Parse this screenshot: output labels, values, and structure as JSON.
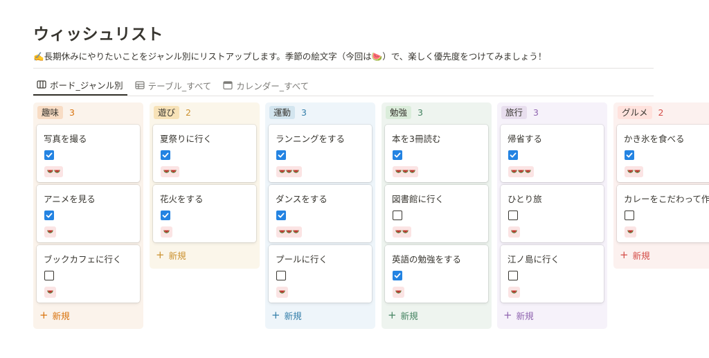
{
  "page": {
    "title": "ウィッシュリスト",
    "description": "✍️長期休みにやりたいことをジャンル別にリストアップします。季節の絵文字（今回は🍉）で、楽しく優先度をつけてみましょう！"
  },
  "tabs": [
    {
      "label": "ボード_ジャンル別",
      "icon": "board-icon",
      "active": true
    },
    {
      "label": "テーブル_すべて",
      "icon": "table-icon",
      "active": false
    },
    {
      "label": "カレンダー_すべて",
      "icon": "calendar-icon",
      "active": false
    }
  ],
  "new_label": "新規",
  "columns": [
    {
      "name": "趣味",
      "count": "3",
      "colors": {
        "bg": "#fbf3eb",
        "pill": "#f8dcc4",
        "text": "#d9730d"
      },
      "cards": [
        {
          "title": "写真を撮る",
          "done": true,
          "priority": 2
        },
        {
          "title": "アニメを見る",
          "done": true,
          "priority": 1
        },
        {
          "title": "ブックカフェに行く",
          "done": false,
          "priority": 1
        }
      ]
    },
    {
      "name": "遊び",
      "count": "2",
      "colors": {
        "bg": "#fbf6ea",
        "pill": "#f7e2b7",
        "text": "#cb912f"
      },
      "cards": [
        {
          "title": "夏祭りに行く",
          "done": true,
          "priority": 2
        },
        {
          "title": "花火をする",
          "done": true,
          "priority": 1
        }
      ]
    },
    {
      "name": "運動",
      "count": "3",
      "colors": {
        "bg": "#eef5fa",
        "pill": "#d3e5ef",
        "text": "#337ea9"
      },
      "cards": [
        {
          "title": "ランニングをする",
          "done": true,
          "priority": 3
        },
        {
          "title": "ダンスをする",
          "done": true,
          "priority": 3
        },
        {
          "title": "プールに行く",
          "done": false,
          "priority": 1
        }
      ]
    },
    {
      "name": "勉強",
      "count": "3",
      "colors": {
        "bg": "#eef4ef",
        "pill": "#dbeddb",
        "text": "#448361"
      },
      "cards": [
        {
          "title": "本を3冊読む",
          "done": true,
          "priority": 3
        },
        {
          "title": "図書館に行く",
          "done": false,
          "priority": 2
        },
        {
          "title": "英語の勉強をする",
          "done": true,
          "priority": 1
        }
      ]
    },
    {
      "name": "旅行",
      "count": "3",
      "colors": {
        "bg": "#f6f2fa",
        "pill": "#e8deee",
        "text": "#9065b0"
      },
      "cards": [
        {
          "title": "帰省する",
          "done": true,
          "priority": 3
        },
        {
          "title": "ひとり旅",
          "done": false,
          "priority": 1
        },
        {
          "title": "江ノ島に行く",
          "done": false,
          "priority": 1
        }
      ]
    },
    {
      "name": "グルメ",
      "count": "2",
      "colors": {
        "bg": "#fcf1ef",
        "pill": "#ffe2dd",
        "text": "#d44c47"
      },
      "cards": [
        {
          "title": "かき氷を食べる",
          "done": true,
          "priority": 2
        },
        {
          "title": "カレーをこだわって作る",
          "done": false,
          "priority": 1
        }
      ]
    }
  ]
}
